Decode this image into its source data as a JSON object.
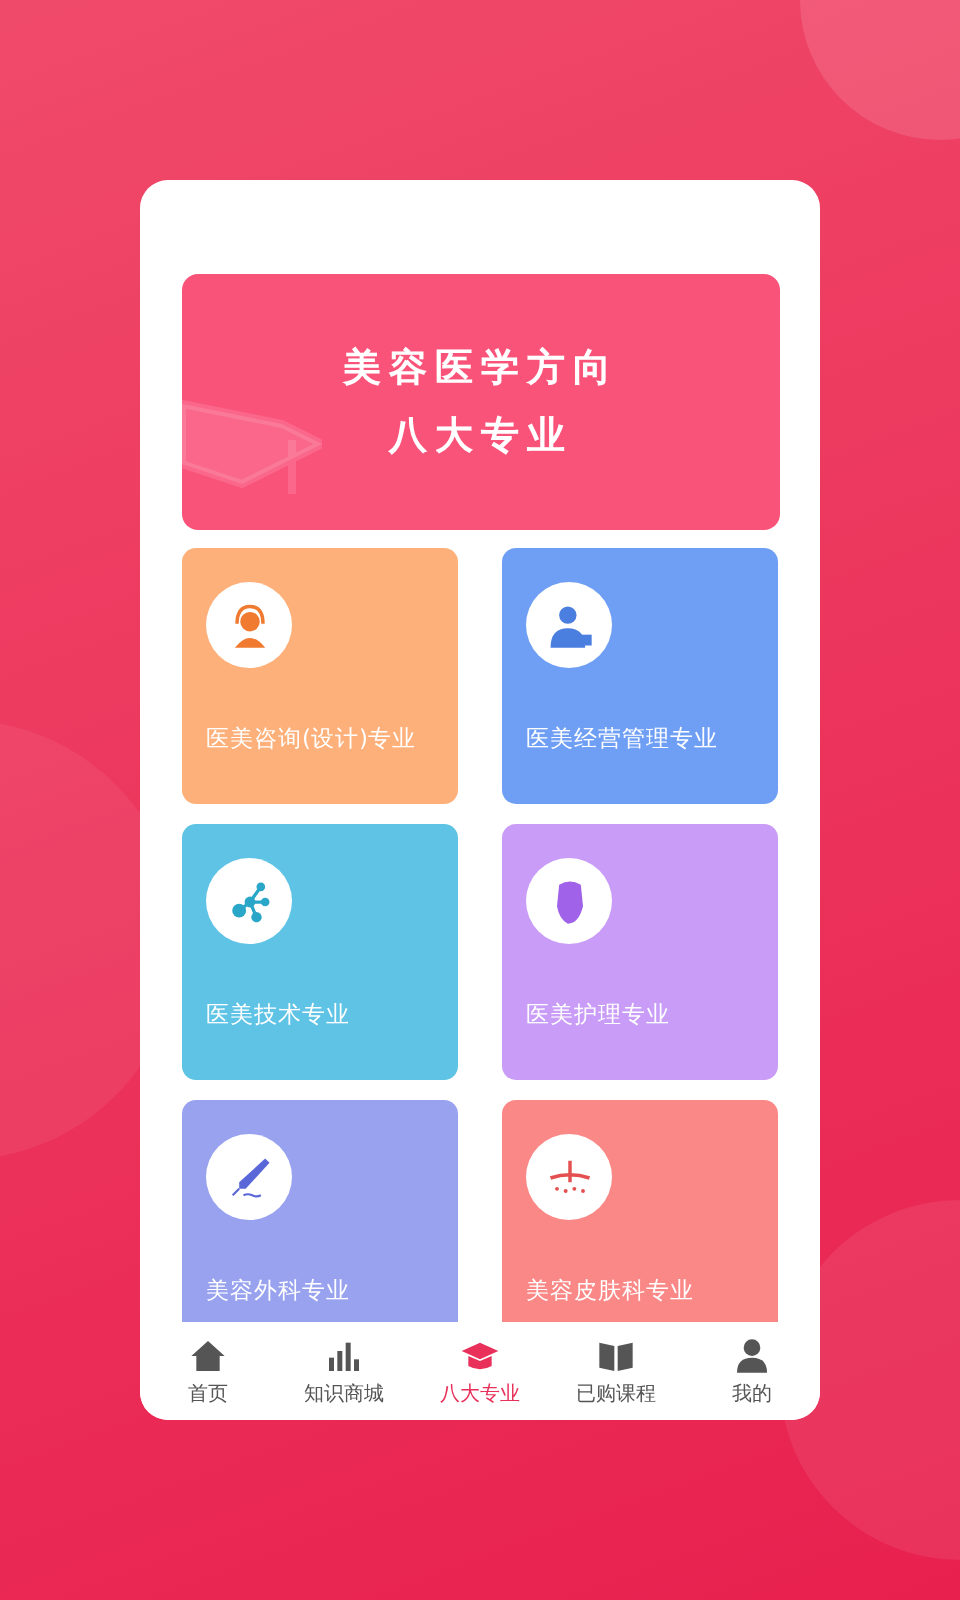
{
  "banner": {
    "title_line_1": "美容医学方向",
    "title_line_2": "八大专业"
  },
  "majors": [
    {
      "label": "医美咨询(设计)专业",
      "kind": "headset",
      "color": "#fdb07a"
    },
    {
      "label": "医美经营管理专业",
      "kind": "manager",
      "color": "#6f9ff5"
    },
    {
      "label": "医美技术专业",
      "kind": "molecule",
      "color": "#5fc3e6"
    },
    {
      "label": "医美护理专业",
      "kind": "mask",
      "color": "#c89cf7"
    },
    {
      "label": "美容外科专业",
      "kind": "scalpel",
      "color": "#98a2ef"
    },
    {
      "label": "美容皮肤科专业",
      "kind": "skin",
      "color": "#fa8887"
    }
  ],
  "tab_bar": [
    {
      "label": "首页",
      "kind": "home",
      "selected": false
    },
    {
      "label": "知识商城",
      "kind": "bars",
      "selected": false
    },
    {
      "label": "八大专业",
      "kind": "cap",
      "selected": true
    },
    {
      "label": "已购课程",
      "kind": "book",
      "selected": false
    },
    {
      "label": "我的",
      "kind": "person",
      "selected": false
    }
  ]
}
